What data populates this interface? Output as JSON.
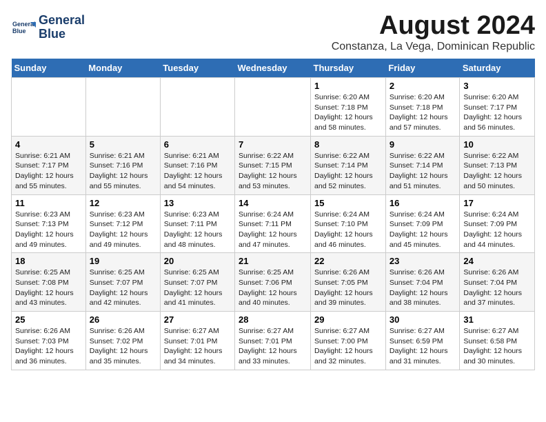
{
  "header": {
    "logo_line1": "General",
    "logo_line2": "Blue",
    "main_title": "August 2024",
    "subtitle": "Constanza, La Vega, Dominican Republic"
  },
  "days_of_week": [
    "Sunday",
    "Monday",
    "Tuesday",
    "Wednesday",
    "Thursday",
    "Friday",
    "Saturday"
  ],
  "weeks": [
    [
      {
        "day": "",
        "sunrise": "",
        "sunset": "",
        "daylight": ""
      },
      {
        "day": "",
        "sunrise": "",
        "sunset": "",
        "daylight": ""
      },
      {
        "day": "",
        "sunrise": "",
        "sunset": "",
        "daylight": ""
      },
      {
        "day": "",
        "sunrise": "",
        "sunset": "",
        "daylight": ""
      },
      {
        "day": "1",
        "sunrise": "Sunrise: 6:20 AM",
        "sunset": "Sunset: 7:18 PM",
        "daylight": "Daylight: 12 hours and 58 minutes."
      },
      {
        "day": "2",
        "sunrise": "Sunrise: 6:20 AM",
        "sunset": "Sunset: 7:18 PM",
        "daylight": "Daylight: 12 hours and 57 minutes."
      },
      {
        "day": "3",
        "sunrise": "Sunrise: 6:20 AM",
        "sunset": "Sunset: 7:17 PM",
        "daylight": "Daylight: 12 hours and 56 minutes."
      }
    ],
    [
      {
        "day": "4",
        "sunrise": "Sunrise: 6:21 AM",
        "sunset": "Sunset: 7:17 PM",
        "daylight": "Daylight: 12 hours and 55 minutes."
      },
      {
        "day": "5",
        "sunrise": "Sunrise: 6:21 AM",
        "sunset": "Sunset: 7:16 PM",
        "daylight": "Daylight: 12 hours and 55 minutes."
      },
      {
        "day": "6",
        "sunrise": "Sunrise: 6:21 AM",
        "sunset": "Sunset: 7:16 PM",
        "daylight": "Daylight: 12 hours and 54 minutes."
      },
      {
        "day": "7",
        "sunrise": "Sunrise: 6:22 AM",
        "sunset": "Sunset: 7:15 PM",
        "daylight": "Daylight: 12 hours and 53 minutes."
      },
      {
        "day": "8",
        "sunrise": "Sunrise: 6:22 AM",
        "sunset": "Sunset: 7:14 PM",
        "daylight": "Daylight: 12 hours and 52 minutes."
      },
      {
        "day": "9",
        "sunrise": "Sunrise: 6:22 AM",
        "sunset": "Sunset: 7:14 PM",
        "daylight": "Daylight: 12 hours and 51 minutes."
      },
      {
        "day": "10",
        "sunrise": "Sunrise: 6:22 AM",
        "sunset": "Sunset: 7:13 PM",
        "daylight": "Daylight: 12 hours and 50 minutes."
      }
    ],
    [
      {
        "day": "11",
        "sunrise": "Sunrise: 6:23 AM",
        "sunset": "Sunset: 7:13 PM",
        "daylight": "Daylight: 12 hours and 49 minutes."
      },
      {
        "day": "12",
        "sunrise": "Sunrise: 6:23 AM",
        "sunset": "Sunset: 7:12 PM",
        "daylight": "Daylight: 12 hours and 49 minutes."
      },
      {
        "day": "13",
        "sunrise": "Sunrise: 6:23 AM",
        "sunset": "Sunset: 7:11 PM",
        "daylight": "Daylight: 12 hours and 48 minutes."
      },
      {
        "day": "14",
        "sunrise": "Sunrise: 6:24 AM",
        "sunset": "Sunset: 7:11 PM",
        "daylight": "Daylight: 12 hours and 47 minutes."
      },
      {
        "day": "15",
        "sunrise": "Sunrise: 6:24 AM",
        "sunset": "Sunset: 7:10 PM",
        "daylight": "Daylight: 12 hours and 46 minutes."
      },
      {
        "day": "16",
        "sunrise": "Sunrise: 6:24 AM",
        "sunset": "Sunset: 7:09 PM",
        "daylight": "Daylight: 12 hours and 45 minutes."
      },
      {
        "day": "17",
        "sunrise": "Sunrise: 6:24 AM",
        "sunset": "Sunset: 7:09 PM",
        "daylight": "Daylight: 12 hours and 44 minutes."
      }
    ],
    [
      {
        "day": "18",
        "sunrise": "Sunrise: 6:25 AM",
        "sunset": "Sunset: 7:08 PM",
        "daylight": "Daylight: 12 hours and 43 minutes."
      },
      {
        "day": "19",
        "sunrise": "Sunrise: 6:25 AM",
        "sunset": "Sunset: 7:07 PM",
        "daylight": "Daylight: 12 hours and 42 minutes."
      },
      {
        "day": "20",
        "sunrise": "Sunrise: 6:25 AM",
        "sunset": "Sunset: 7:07 PM",
        "daylight": "Daylight: 12 hours and 41 minutes."
      },
      {
        "day": "21",
        "sunrise": "Sunrise: 6:25 AM",
        "sunset": "Sunset: 7:06 PM",
        "daylight": "Daylight: 12 hours and 40 minutes."
      },
      {
        "day": "22",
        "sunrise": "Sunrise: 6:26 AM",
        "sunset": "Sunset: 7:05 PM",
        "daylight": "Daylight: 12 hours and 39 minutes."
      },
      {
        "day": "23",
        "sunrise": "Sunrise: 6:26 AM",
        "sunset": "Sunset: 7:04 PM",
        "daylight": "Daylight: 12 hours and 38 minutes."
      },
      {
        "day": "24",
        "sunrise": "Sunrise: 6:26 AM",
        "sunset": "Sunset: 7:04 PM",
        "daylight": "Daylight: 12 hours and 37 minutes."
      }
    ],
    [
      {
        "day": "25",
        "sunrise": "Sunrise: 6:26 AM",
        "sunset": "Sunset: 7:03 PM",
        "daylight": "Daylight: 12 hours and 36 minutes."
      },
      {
        "day": "26",
        "sunrise": "Sunrise: 6:26 AM",
        "sunset": "Sunset: 7:02 PM",
        "daylight": "Daylight: 12 hours and 35 minutes."
      },
      {
        "day": "27",
        "sunrise": "Sunrise: 6:27 AM",
        "sunset": "Sunset: 7:01 PM",
        "daylight": "Daylight: 12 hours and 34 minutes."
      },
      {
        "day": "28",
        "sunrise": "Sunrise: 6:27 AM",
        "sunset": "Sunset: 7:01 PM",
        "daylight": "Daylight: 12 hours and 33 minutes."
      },
      {
        "day": "29",
        "sunrise": "Sunrise: 6:27 AM",
        "sunset": "Sunset: 7:00 PM",
        "daylight": "Daylight: 12 hours and 32 minutes."
      },
      {
        "day": "30",
        "sunrise": "Sunrise: 6:27 AM",
        "sunset": "Sunset: 6:59 PM",
        "daylight": "Daylight: 12 hours and 31 minutes."
      },
      {
        "day": "31",
        "sunrise": "Sunrise: 6:27 AM",
        "sunset": "Sunset: 6:58 PM",
        "daylight": "Daylight: 12 hours and 30 minutes."
      }
    ]
  ]
}
